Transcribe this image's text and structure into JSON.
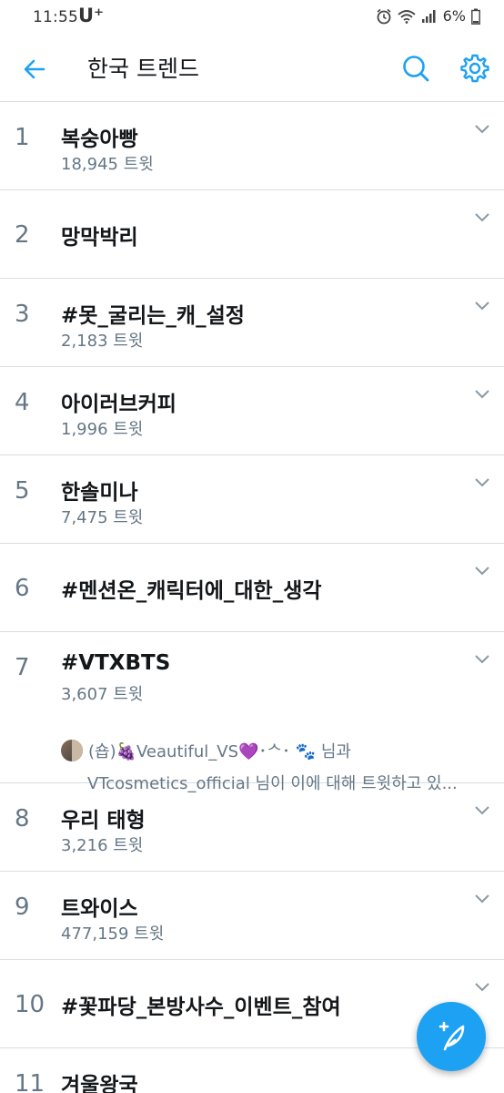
{
  "status_bar": {
    "time": "11:55",
    "carrier": "U⁺",
    "battery": "6%"
  },
  "header": {
    "title": "한국 트렌드",
    "accent_color": "#1da1f2"
  },
  "trends": [
    {
      "rank": "1",
      "name": "복숭아빵",
      "count": "18,945 트윗"
    },
    {
      "rank": "2",
      "name": "망막박리",
      "count": ""
    },
    {
      "rank": "3",
      "name": "#못_굴리는_캐_설정",
      "count": "2,183 트윗"
    },
    {
      "rank": "4",
      "name": "아이러브커피",
      "count": "1,996 트윗"
    },
    {
      "rank": "5",
      "name": "한솔미나",
      "count": "7,475 트윗"
    },
    {
      "rank": "6",
      "name": "#멘션온_캐릭터에_대한_생각",
      "count": ""
    },
    {
      "rank": "7",
      "name": "#VTXBTS",
      "count": "3,607 트윗",
      "context_line1": "(숍)🍇Veautiful_VS💜･ᄉ･ 🐾 님과",
      "context_line2": "VTcosmetics_official 님이 이에 대해 트윗하고 있..."
    },
    {
      "rank": "8",
      "name": "우리 태형",
      "count": "3,216 트윗"
    },
    {
      "rank": "9",
      "name": "트와이스",
      "count": "477,159 트윗"
    },
    {
      "rank": "10",
      "name": "#꽃파당_본방사수_이벤트_참여",
      "count": ""
    },
    {
      "rank": "11",
      "name": "겨울왕국",
      "count": ""
    }
  ],
  "icons": {
    "back": "arrow-left-icon",
    "search": "search-icon",
    "settings": "gear-icon",
    "chevron": "chevron-down-icon",
    "compose": "compose-tweet-icon"
  }
}
